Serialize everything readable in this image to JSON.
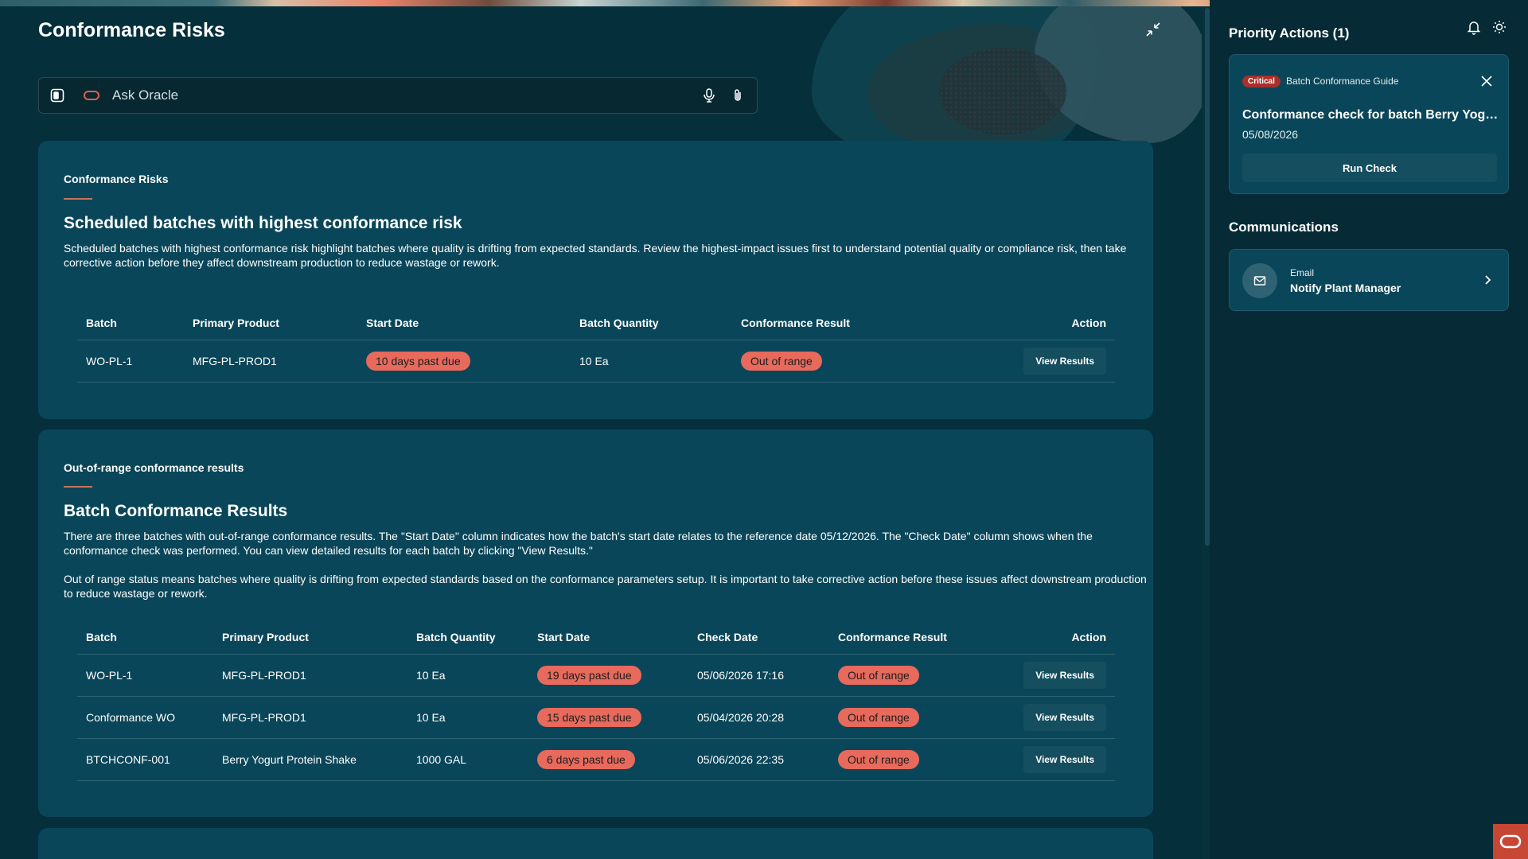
{
  "page": {
    "title": "Conformance Risks",
    "ask_placeholder": "Ask Oracle"
  },
  "card1": {
    "eyebrow": "Conformance Risks",
    "heading": "Scheduled batches with highest conformance risk",
    "description": "Scheduled batches with highest conformance risk highlight batches where quality is drifting from expected standards. Review the highest-impact issues first to understand potential quality or compliance risk, then take corrective action before they affect downstream production to reduce wastage or rework.",
    "columns": [
      "Batch",
      "Primary Product",
      "Start Date",
      "Batch Quantity",
      "Conformance Result",
      "Action"
    ],
    "rows": [
      {
        "batch": "WO-PL-1",
        "product": "MFG-PL-PROD1",
        "start": "10 days past due",
        "quantity": "10 Ea",
        "result": "Out of range",
        "action": "View Results"
      }
    ]
  },
  "card2": {
    "eyebrow": "Out-of-range conformance results",
    "heading": "Batch Conformance Results",
    "description1": "There are three batches with out-of-range conformance results. The \"Start Date\" column indicates how the batch's start date relates to the reference date 05/12/2026. The \"Check Date\" column shows when the conformance check was performed. You can view detailed results for each batch by clicking \"View Results.\"",
    "description2": "Out of range status means batches where quality is drifting from expected standards based on the conformance parameters setup. It is important to take corrective action before these issues affect downstream production to reduce wastage or rework.",
    "columns": [
      "Batch",
      "Primary Product",
      "Batch Quantity",
      "Start Date",
      "Check Date",
      "Conformance Result",
      "Action"
    ],
    "rows": [
      {
        "batch": "WO-PL-1",
        "product": "MFG-PL-PROD1",
        "quantity": "10 Ea",
        "start": "19 days past due",
        "check": "05/06/2026 17:16",
        "result": "Out of range",
        "action": "View Results"
      },
      {
        "batch": "Conformance WO",
        "product": "MFG-PL-PROD1",
        "quantity": "10 Ea",
        "start": "15 days past due",
        "check": "05/04/2026 20:28",
        "result": "Out of range",
        "action": "View Results"
      },
      {
        "batch": "BTCHCONF-001",
        "product": "Berry Yogurt Protein Shake",
        "quantity": "1000 GAL",
        "start": "6 days past due",
        "check": "05/06/2026 22:35",
        "result": "Out of range",
        "action": "View Results"
      }
    ]
  },
  "right_panel": {
    "priority_title": "Priority Actions (1)",
    "priority_card": {
      "badge": "Critical",
      "source": "Batch Conformance Guide",
      "title": "Conformance check for batch Berry Yogurt Protein Shake",
      "date": "05/08/2026",
      "button": "Run Check"
    },
    "communications_title": "Communications",
    "communication": {
      "type": "Email",
      "name": "Notify Plant Manager"
    }
  },
  "icons": {
    "collapse": "collapse-icon",
    "panel": "panel-toggle-icon",
    "oracle": "oracle-logo-icon",
    "mic": "microphone-icon",
    "attach": "paperclip-icon",
    "bell": "bell-icon",
    "theme": "sun-icon",
    "close": "close-icon",
    "mail": "mail-icon",
    "chevron": "chevron-right-icon"
  },
  "colors": {
    "background": "#052f3b",
    "card": "#0a4659",
    "pill": "#e76a5c",
    "critical": "#a8302a",
    "accent_line": "#c8745a",
    "oracle_red": "#c74634"
  }
}
